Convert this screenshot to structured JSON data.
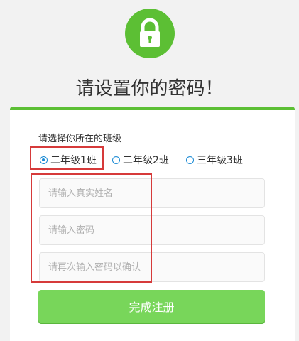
{
  "header": {
    "icon": "lock-icon",
    "title": "请设置你的密码！"
  },
  "form": {
    "class_prompt": "请选择你所在的班级",
    "class_options": [
      {
        "label": "二年级1班",
        "selected": true
      },
      {
        "label": "二年级2班",
        "selected": false
      },
      {
        "label": "三年级3班",
        "selected": false
      }
    ],
    "name_placeholder": "请输入真实姓名",
    "password_placeholder": "请输入密码",
    "confirm_placeholder": "请再次输入密码以确认",
    "submit_label": "完成注册"
  },
  "colors": {
    "brand_green": "#5cbf34",
    "button_green": "#78d65a",
    "radio_blue": "#1a8ad4",
    "highlight_red": "#d63a3a"
  }
}
